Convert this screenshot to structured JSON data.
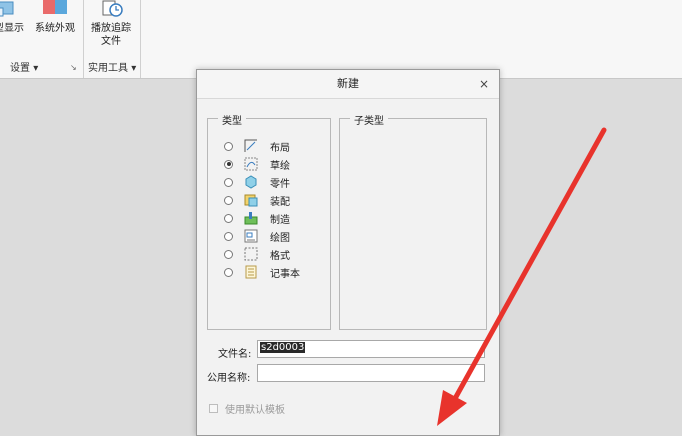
{
  "ribbon": {
    "btn_model_display": "型显示",
    "btn_system_appearance": "系统外观",
    "btn_playback_line1": "播放追踪",
    "btn_playback_line2": "文件",
    "group_settings": "设置",
    "group_tools": "实用工具",
    "dropdown_glyph": "▾",
    "launcher_glyph": "↘"
  },
  "dialog": {
    "title": "新建",
    "close_glyph": "×",
    "type_group": "类型",
    "subtype_group": "子类型",
    "types": [
      {
        "label": "布局",
        "checked": false,
        "icon": "layout-icon"
      },
      {
        "label": "草绘",
        "checked": true,
        "icon": "sketch-icon"
      },
      {
        "label": "零件",
        "checked": false,
        "icon": "part-icon"
      },
      {
        "label": "装配",
        "checked": false,
        "icon": "assembly-icon"
      },
      {
        "label": "制造",
        "checked": false,
        "icon": "manufacturing-icon"
      },
      {
        "label": "绘图",
        "checked": false,
        "icon": "drawing-icon"
      },
      {
        "label": "格式",
        "checked": false,
        "icon": "format-icon"
      },
      {
        "label": "记事本",
        "checked": false,
        "icon": "notebook-icon"
      }
    ],
    "filename_label": "文件名:",
    "filename_value": "s2d0003",
    "common_name_label": "公用名称:",
    "common_name_value": "",
    "use_default_template": "使用默认模板"
  },
  "colors": {
    "arrow": "#e8332c",
    "selection": "#2a2a2a"
  }
}
